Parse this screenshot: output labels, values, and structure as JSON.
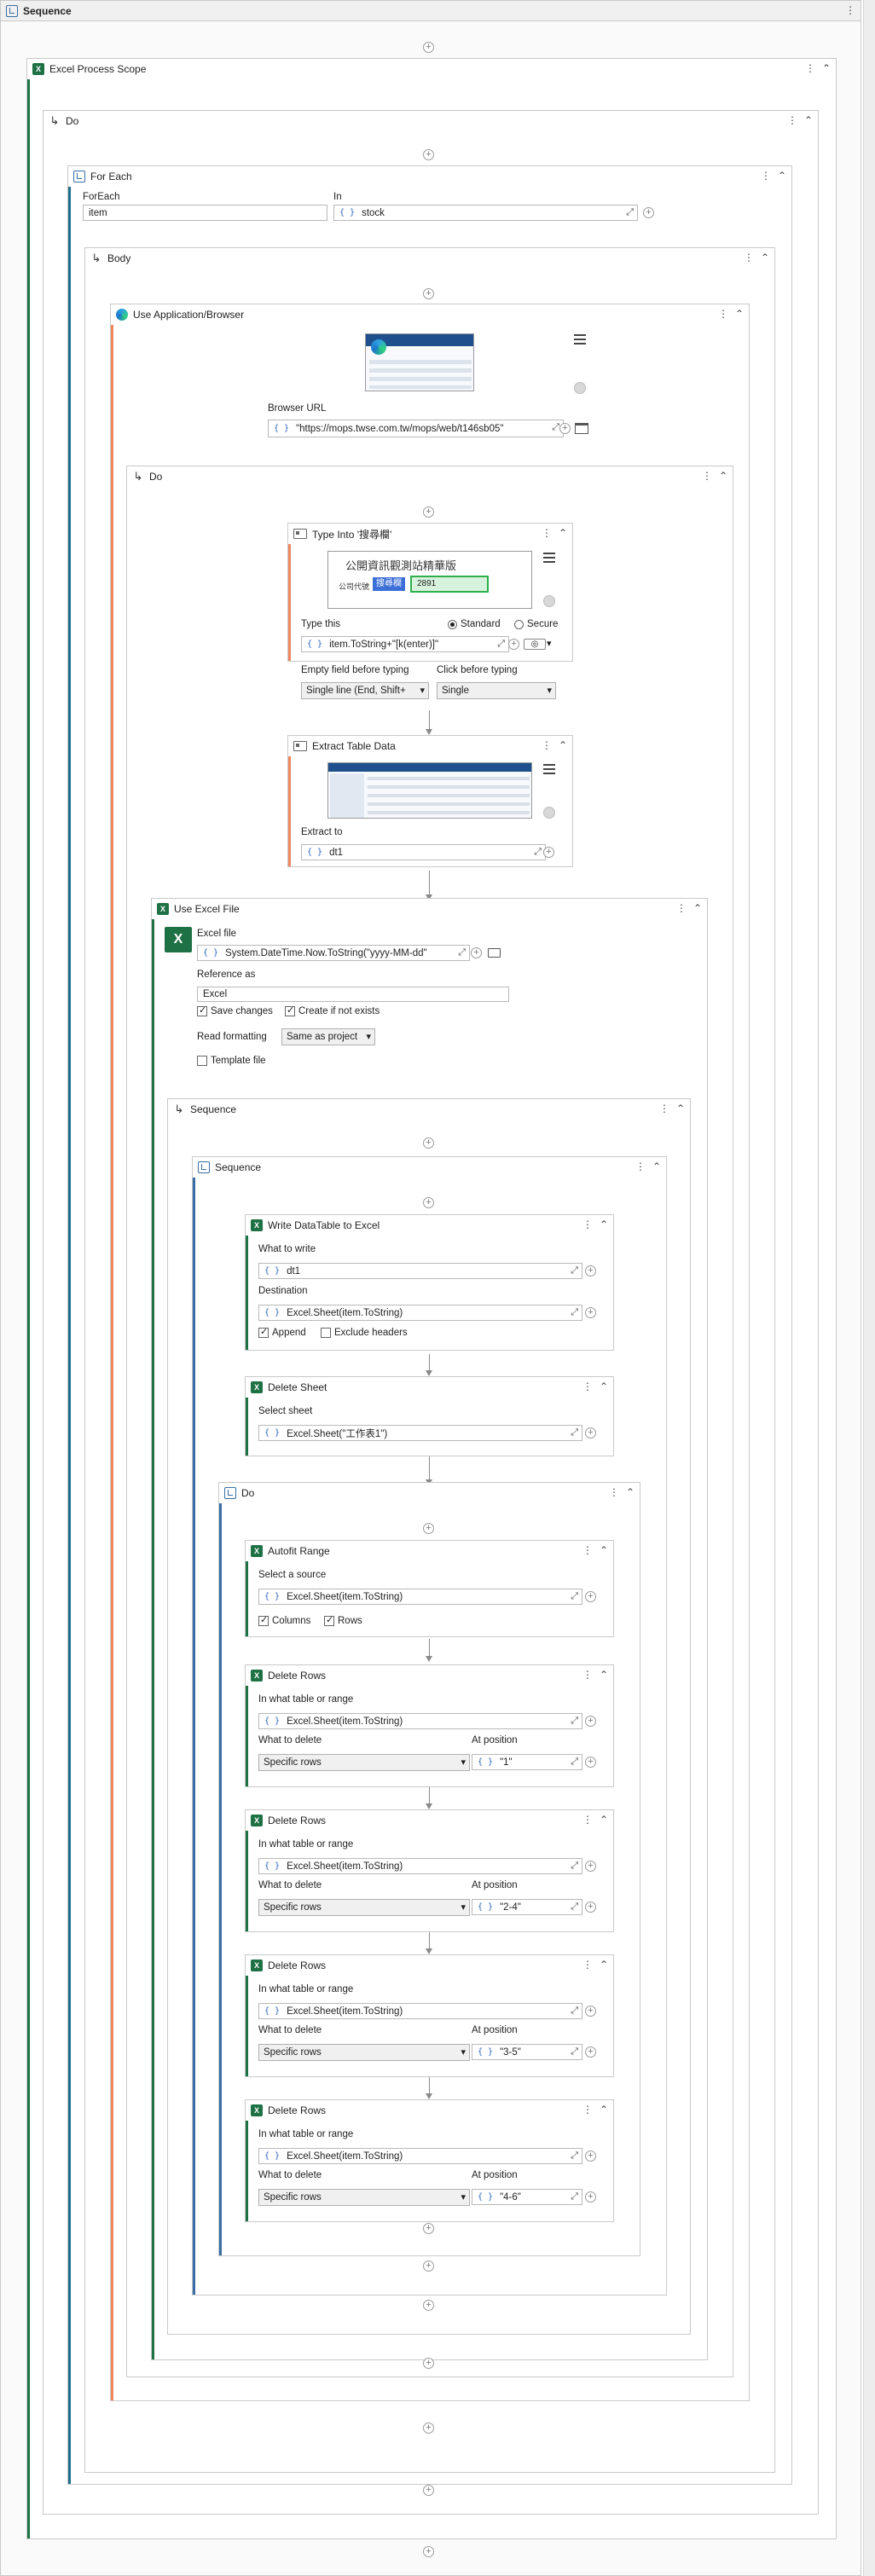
{
  "root": {
    "title": "Sequence"
  },
  "excel_process_scope": {
    "title": "Excel Process Scope"
  },
  "do_outer": {
    "title": "Do"
  },
  "for_each": {
    "title": "For Each",
    "foreach_label": "ForEach",
    "item_value": "item",
    "in_label": "In",
    "in_value": "stock"
  },
  "body": {
    "title": "Body"
  },
  "use_browser": {
    "title": "Use Application/Browser",
    "url_label": "Browser URL",
    "url_value": "\"https://mops.twse.com.tw/mops/web/t146sb05\""
  },
  "do_browser": {
    "title": "Do"
  },
  "type_into": {
    "title": "Type Into '搜尋欄'",
    "thumb_heading": "公開資訊觀測站精華版",
    "thumb_sub": "公司代號",
    "thumb_tag": "搜尋欄",
    "thumb_value": "2891",
    "type_label": "Type this",
    "radio_standard": "Standard",
    "radio_secure": "Secure",
    "type_value": "item.ToString+\"[k(enter)]\"",
    "empty_label": "Empty field before typing",
    "empty_value": "Single line (End, Shift+",
    "click_label": "Click before typing",
    "click_value": "Single"
  },
  "extract": {
    "title": "Extract Table Data",
    "extract_label": "Extract to",
    "extract_value": "dt1"
  },
  "use_excel": {
    "title": "Use Excel File",
    "file_label": "Excel file",
    "file_value": "System.DateTime.Now.ToString(\"yyyy-MM-dd\"",
    "ref_label": "Reference as",
    "ref_value": "Excel",
    "save_changes": "Save changes",
    "create_if_not_exists": "Create if not exists",
    "read_label": "Read formatting",
    "read_value": "Same as project",
    "template_file": "Template file"
  },
  "sequence_a": {
    "title": "Sequence"
  },
  "sequence_b": {
    "title": "Sequence"
  },
  "write_dt": {
    "title": "Write DataTable to Excel",
    "what_label": "What to write",
    "what_value": "dt1",
    "dest_label": "Destination",
    "dest_value": "Excel.Sheet(item.ToString)",
    "append": "Append",
    "exclude_headers": "Exclude headers"
  },
  "delete_sheet": {
    "title": "Delete Sheet",
    "select_label": "Select sheet",
    "select_value": "Excel.Sheet(\"工作表1\")"
  },
  "do_inner": {
    "title": "Do"
  },
  "autofit": {
    "title": "Autofit Range",
    "source_label": "Select a source",
    "source_value": "Excel.Sheet(item.ToString)",
    "columns": "Columns",
    "rows": "Rows"
  },
  "delete_rows": [
    {
      "title": "Delete Rows",
      "table_label": "In what table or range",
      "table_value": "Excel.Sheet(item.ToString)",
      "what_label": "What to delete",
      "what_value": "Specific rows",
      "pos_label": "At position",
      "pos_value": "\"1\""
    },
    {
      "title": "Delete Rows",
      "table_label": "In what table or range",
      "table_value": "Excel.Sheet(item.ToString)",
      "what_label": "What to delete",
      "what_value": "Specific rows",
      "pos_label": "At position",
      "pos_value": "\"2-4\""
    },
    {
      "title": "Delete Rows",
      "table_label": "In what table or range",
      "table_value": "Excel.Sheet(item.ToString)",
      "what_label": "What to delete",
      "what_value": "Specific rows",
      "pos_label": "At position",
      "pos_value": "\"3-5\""
    },
    {
      "title": "Delete Rows",
      "table_label": "In what table or range",
      "table_value": "Excel.Sheet(item.ToString)",
      "what_label": "What to delete",
      "what_value": "Specific rows",
      "pos_label": "At position",
      "pos_value": "\"4-6\""
    }
  ],
  "icons": {
    "expand": "⤢",
    "add": "+",
    "menu": "⋮",
    "collapse": "⌃",
    "brace": "{ }",
    "do_arrow": "↳"
  },
  "colors": {
    "excel_green": "#1e7145",
    "ui_orange": "#f0875f",
    "sequence_blue": "#3a6ea5",
    "accent_teal": "#1f6f8b"
  }
}
